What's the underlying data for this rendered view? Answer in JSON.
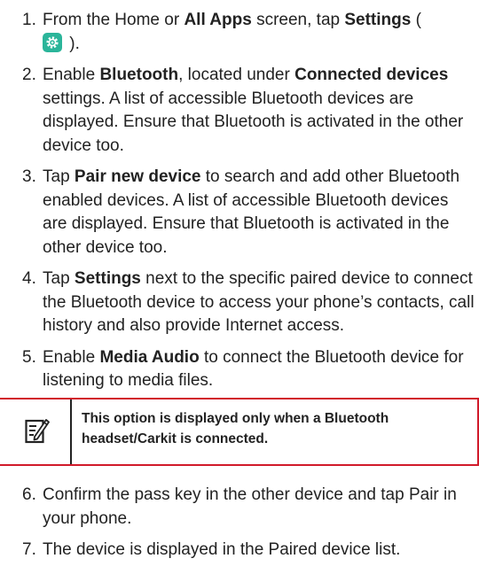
{
  "steps": [
    {
      "num": "1.",
      "line1_pre": "From the Home or ",
      "line1_b1": "All Apps",
      "line1_mid": " screen, tap ",
      "line1_b2": "Settings",
      "line1_post": " (",
      "line2_post": " ).",
      "icon": "settings-gear-icon"
    },
    {
      "num": "2.",
      "pre": "Enable ",
      "b1": "Bluetooth",
      "mid": ", located under ",
      "b2": "Connected devices",
      "post": " settings. A list of accessible Bluetooth devices are displayed. Ensure that Bluetooth is activated in the other device too."
    },
    {
      "num": "3.",
      "pre": "Tap ",
      "b1": "Pair new device",
      "post": " to search and add other Bluetooth enabled devices. A list of accessible Bluetooth devices are displayed. Ensure that Bluetooth is activated in the other device too."
    },
    {
      "num": "4.",
      "pre": "Tap ",
      "b1": "Settings",
      "post": " next to the specific paired device to connect the Bluetooth device to access your phone’s contacts, call history and also provide Internet access."
    },
    {
      "num": "5.",
      "pre": "Enable ",
      "b1": "Media Audio",
      "post": " to connect the Bluetooth device for listening to media files."
    }
  ],
  "note": {
    "icon": "note-pencil-icon",
    "text": "This option is displayed only when a Bluetooth headset/Carkit is connected."
  },
  "steps_after": [
    {
      "num": "6.",
      "text": "Confirm the pass key in the other device and tap Pair in your phone."
    },
    {
      "num": "7.",
      "text": "The device is displayed in the Paired device list."
    }
  ],
  "colors": {
    "accent_red": "#d11a2a",
    "icon_teal": "#2bb59a"
  }
}
